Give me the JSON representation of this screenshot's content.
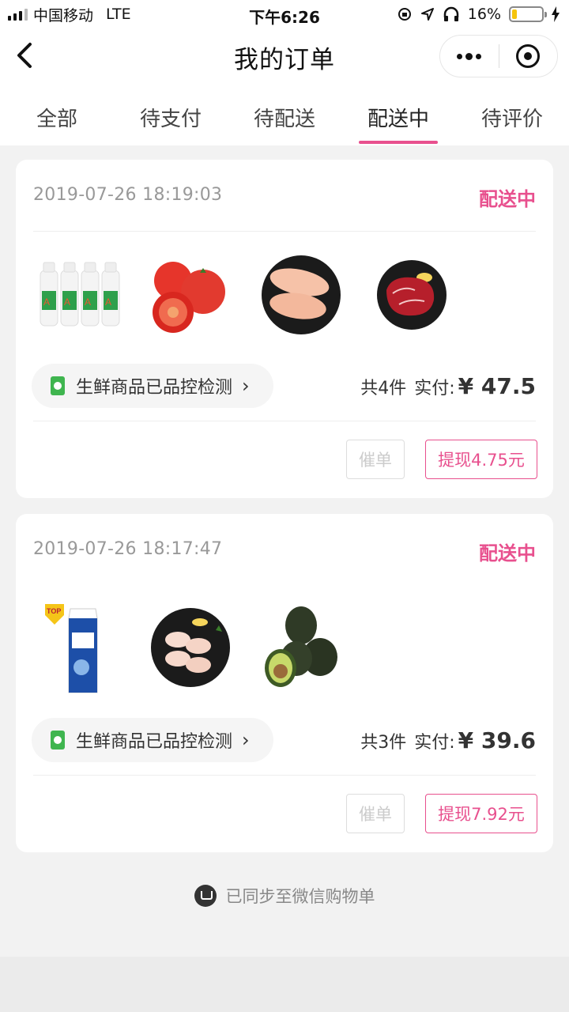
{
  "status_bar": {
    "carrier": "中国移动",
    "network": "LTE",
    "time": "下午6:26",
    "battery_percent": "16%",
    "battery_level": 0.16
  },
  "navbar": {
    "title": "我的订单",
    "back_icon": "chevron-left-icon",
    "more_icon": "more-dots-icon",
    "close_icon": "target-icon"
  },
  "tabs": [
    {
      "label": "全部"
    },
    {
      "label": "待支付"
    },
    {
      "label": "待配送"
    },
    {
      "label": "配送中",
      "active": true
    },
    {
      "label": "待评价"
    }
  ],
  "orders": [
    {
      "time": "2019-07-26 18:19:03",
      "status": "配送中",
      "products": [
        "milk-bottles",
        "tomatoes",
        "chicken-breast",
        "beef-steak"
      ],
      "qc_text": "生鲜商品已品控检测",
      "count": "共4件",
      "paid_label": "实付:",
      "amount": "¥ 47.5",
      "urge_label": "催单",
      "withdraw_label": "提现4.75元"
    },
    {
      "time": "2019-07-26 18:17:47",
      "status": "配送中",
      "products": [
        "milk-carton",
        "chicken-wings",
        "avocados"
      ],
      "qc_text": "生鲜商品已品控检测",
      "count": "共3件",
      "paid_label": "实付:",
      "amount": "¥ 39.6",
      "urge_label": "催单",
      "withdraw_label": "提现7.92元"
    }
  ],
  "footer": {
    "sync_text": "已同步至微信购物单"
  },
  "colors": {
    "accent": "#e8508e",
    "qc_green": "#3fb54f"
  }
}
